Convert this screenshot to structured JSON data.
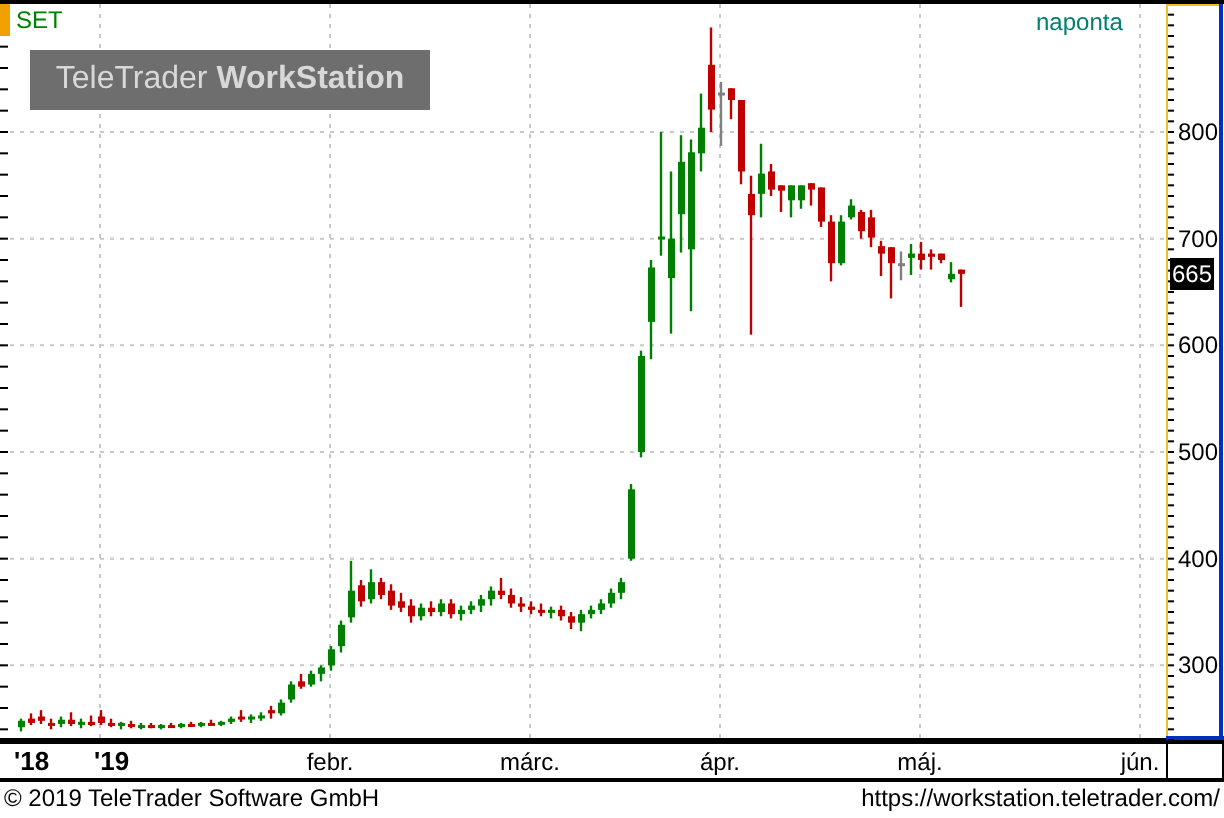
{
  "chart": {
    "symbol": "SET",
    "interval": "naponta",
    "logo": "TeleTrader **WorkStation**",
    "last_price": "665",
    "chart_data": {
      "type": "candlestick",
      "grid": true,
      "ylim": [
        230,
        920
      ],
      "yticks": [
        {
          "value": 300,
          "label": "300"
        },
        {
          "value": 400,
          "label": "400"
        },
        {
          "value": 500,
          "label": "500"
        },
        {
          "value": 600,
          "label": "600"
        },
        {
          "value": 700,
          "label": "700"
        },
        {
          "value": 800,
          "label": "800"
        }
      ],
      "categories": [
        "'18",
        null,
        null,
        null,
        null,
        null,
        null,
        null,
        "'19",
        null,
        null,
        null,
        null,
        null,
        null,
        null,
        null,
        null,
        null,
        null,
        null,
        null,
        null,
        null,
        null,
        null,
        null,
        null,
        null,
        null,
        null,
        "febr.",
        null,
        null,
        null,
        null,
        null,
        null,
        null,
        null,
        null,
        null,
        null,
        null,
        null,
        null,
        null,
        null,
        null,
        null,
        null,
        "márc.",
        null,
        null,
        null,
        null,
        null,
        null,
        null,
        null,
        null,
        null,
        null,
        null,
        null,
        null,
        null,
        null,
        null,
        null,
        "ápr.",
        null,
        null,
        null,
        null,
        null,
        null,
        null,
        null,
        null,
        null,
        null,
        null,
        null,
        null,
        null,
        null,
        null,
        null,
        null,
        "máj.",
        null,
        null,
        null,
        null,
        null,
        null,
        null,
        null,
        null,
        null,
        null,
        null,
        null,
        null,
        null,
        null,
        null,
        null,
        null,
        null,
        null,
        "jún."
      ],
      "ohlc": [
        [
          242,
          250,
          238,
          248
        ],
        [
          250,
          255,
          244,
          246
        ],
        [
          252,
          258,
          245,
          248
        ],
        [
          246,
          250,
          240,
          244
        ],
        [
          245,
          252,
          242,
          249
        ],
        [
          249,
          256,
          243,
          245
        ],
        [
          245,
          250,
          241,
          247
        ],
        [
          247,
          253,
          243,
          244
        ],
        [
          252,
          258,
          244,
          246
        ],
        [
          246,
          250,
          242,
          244
        ],
        [
          244,
          247,
          240,
          246
        ],
        [
          245,
          248,
          241,
          243
        ],
        [
          243,
          246,
          240,
          244
        ],
        [
          244,
          246,
          241,
          242
        ],
        [
          242,
          245,
          240,
          244
        ],
        [
          244,
          246,
          242,
          243
        ],
        [
          243,
          246,
          241,
          245
        ],
        [
          245,
          247,
          243,
          244
        ],
        [
          244,
          247,
          242,
          246
        ],
        [
          246,
          249,
          244,
          245
        ],
        [
          245,
          248,
          243,
          247
        ],
        [
          247,
          252,
          245,
          250
        ],
        [
          252,
          258,
          247,
          250
        ],
        [
          250,
          254,
          246,
          252
        ],
        [
          252,
          256,
          248,
          253
        ],
        [
          258,
          262,
          250,
          255
        ],
        [
          255,
          268,
          253,
          265
        ],
        [
          268,
          285,
          265,
          282
        ],
        [
          285,
          292,
          278,
          280
        ],
        [
          282,
          295,
          280,
          292
        ],
        [
          292,
          300,
          285,
          298
        ],
        [
          300,
          318,
          295,
          315
        ],
        [
          318,
          342,
          312,
          338
        ],
        [
          345,
          398,
          340,
          370
        ],
        [
          375,
          380,
          355,
          360
        ],
        [
          362,
          390,
          358,
          378
        ],
        [
          378,
          382,
          362,
          366
        ],
        [
          370,
          376,
          352,
          356
        ],
        [
          360,
          368,
          350,
          354
        ],
        [
          356,
          362,
          340,
          346
        ],
        [
          346,
          358,
          342,
          354
        ],
        [
          354,
          360,
          346,
          350
        ],
        [
          350,
          362,
          346,
          358
        ],
        [
          358,
          362,
          344,
          348
        ],
        [
          348,
          356,
          342,
          352
        ],
        [
          352,
          360,
          348,
          356
        ],
        [
          356,
          366,
          350,
          362
        ],
        [
          362,
          374,
          356,
          370
        ],
        [
          370,
          382,
          362,
          366
        ],
        [
          366,
          372,
          354,
          358
        ],
        [
          358,
          364,
          350,
          355
        ],
        [
          355,
          360,
          348,
          352
        ],
        [
          352,
          358,
          346,
          350
        ],
        [
          350,
          355,
          344,
          352
        ],
        [
          352,
          356,
          342,
          346
        ],
        [
          346,
          350,
          334,
          340
        ],
        [
          340,
          352,
          332,
          348
        ],
        [
          348,
          356,
          344,
          352
        ],
        [
          352,
          362,
          348,
          358
        ],
        [
          358,
          372,
          354,
          368
        ],
        [
          368,
          382,
          362,
          378
        ],
        [
          400,
          470,
          398,
          465
        ],
        [
          500,
          595,
          495,
          590
        ],
        [
          622,
          680,
          587,
          673
        ],
        [
          700,
          800,
          684,
          702
        ],
        [
          663,
          763,
          611,
          700
        ],
        [
          723,
          797,
          687,
          772
        ],
        [
          690,
          793,
          632,
          781
        ],
        [
          780,
          836,
          763,
          804
        ],
        [
          863,
          898,
          800,
          821
        ],
        [
          837,
          847,
          787,
          837
        ],
        [
          841,
          841,
          812,
          830
        ],
        [
          830,
          830,
          751,
          763
        ],
        [
          742,
          759,
          610,
          722
        ],
        [
          742,
          789,
          720,
          761
        ],
        [
          763,
          770,
          740,
          746
        ],
        [
          750,
          750,
          725,
          745
        ],
        [
          736,
          750,
          720,
          750
        ],
        [
          736,
          750,
          728,
          750
        ],
        [
          752,
          752,
          731,
          746
        ],
        [
          748,
          748,
          711,
          716
        ],
        [
          716,
          722,
          660,
          677
        ],
        [
          677,
          722,
          675,
          716
        ],
        [
          720,
          737,
          718,
          731
        ],
        [
          725,
          727,
          700,
          707
        ],
        [
          720,
          727,
          692,
          701
        ],
        [
          693,
          698,
          665,
          686
        ],
        [
          692,
          692,
          644,
          677
        ],
        [
          677,
          688,
          661,
          677
        ],
        [
          682,
          695,
          666,
          686
        ],
        [
          686,
          697,
          671,
          680
        ],
        [
          686,
          690,
          671,
          683
        ],
        [
          686,
          686,
          677,
          680
        ],
        [
          662,
          678,
          659,
          667
        ],
        [
          671,
          671,
          636,
          667
        ],
        null,
        null,
        null,
        null,
        null,
        null,
        null,
        null,
        null,
        null,
        null,
        null,
        null,
        null,
        null,
        null,
        null,
        null
      ]
    }
  },
  "footer": {
    "copyright": "© 2019 TeleTrader Software GmbH",
    "url": "https://workstation.teletrader.com/"
  }
}
